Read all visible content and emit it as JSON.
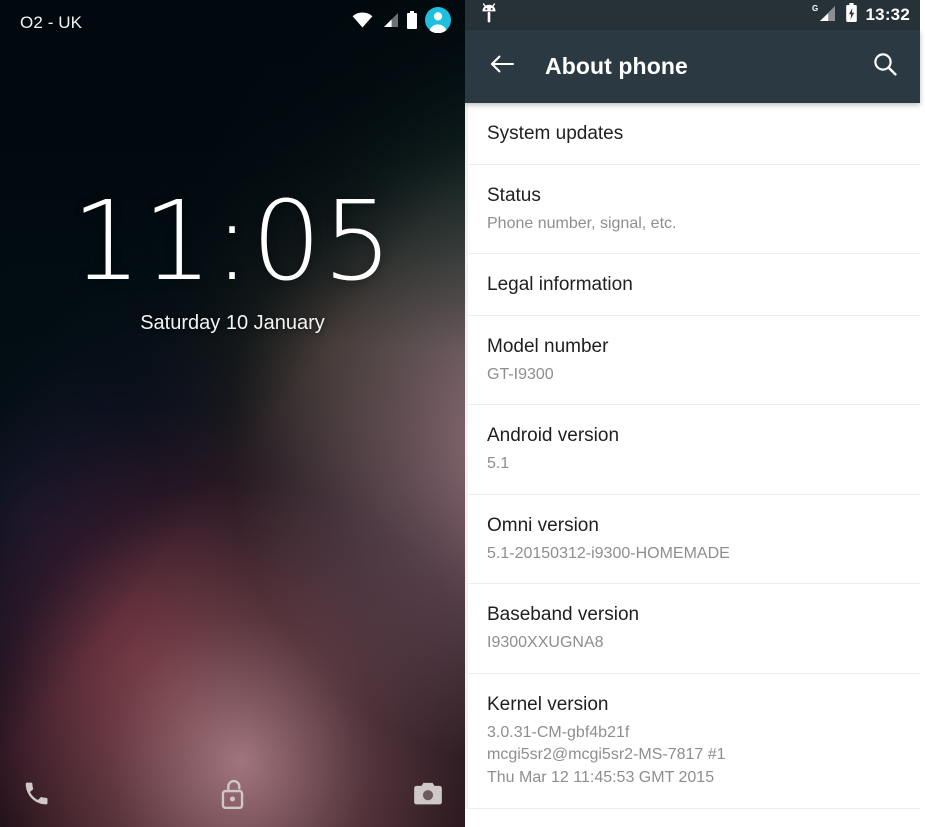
{
  "lockscreen": {
    "carrier": "O2 - UK",
    "clock": "11:05",
    "date": "Saturday 10 January",
    "status_icons": [
      "wifi-icon",
      "cell-signal-icon",
      "battery-icon",
      "user-avatar-icon"
    ],
    "shortcuts": [
      "phone-icon",
      "unlock-padlock-icon",
      "camera-icon"
    ],
    "colors": {
      "background": "#010e12",
      "avatar_accent": "#1ec0dd"
    }
  },
  "settings": {
    "status_bar": {
      "left_icon": "android-droid-icon",
      "network_label": "G",
      "icons": [
        "cell-signal-icon",
        "battery-charging-icon"
      ],
      "time": "13:32"
    },
    "action_bar": {
      "back_icon": "arrow-left-icon",
      "title": "About phone",
      "search_icon": "search-icon",
      "background": "#2b3a42"
    },
    "items": [
      {
        "title": "System updates",
        "subtitle": ""
      },
      {
        "title": "Status",
        "subtitle": "Phone number, signal, etc."
      },
      {
        "title": "Legal information",
        "subtitle": ""
      },
      {
        "title": "Model number",
        "subtitle": "GT-I9300"
      },
      {
        "title": "Android version",
        "subtitle": "5.1"
      },
      {
        "title": "Omni version",
        "subtitle": "5.1-20150312-i9300-HOMEMADE"
      },
      {
        "title": "Baseband version",
        "subtitle": "I9300XXUGNA8"
      },
      {
        "title": "Kernel version",
        "subtitle_lines": [
          "3.0.31-CM-gbf4b21f",
          "mcgi5sr2@mcgi5sr2-MS-7817 #1",
          "Thu Mar 12 11:45:53 GMT 2015"
        ]
      }
    ]
  }
}
